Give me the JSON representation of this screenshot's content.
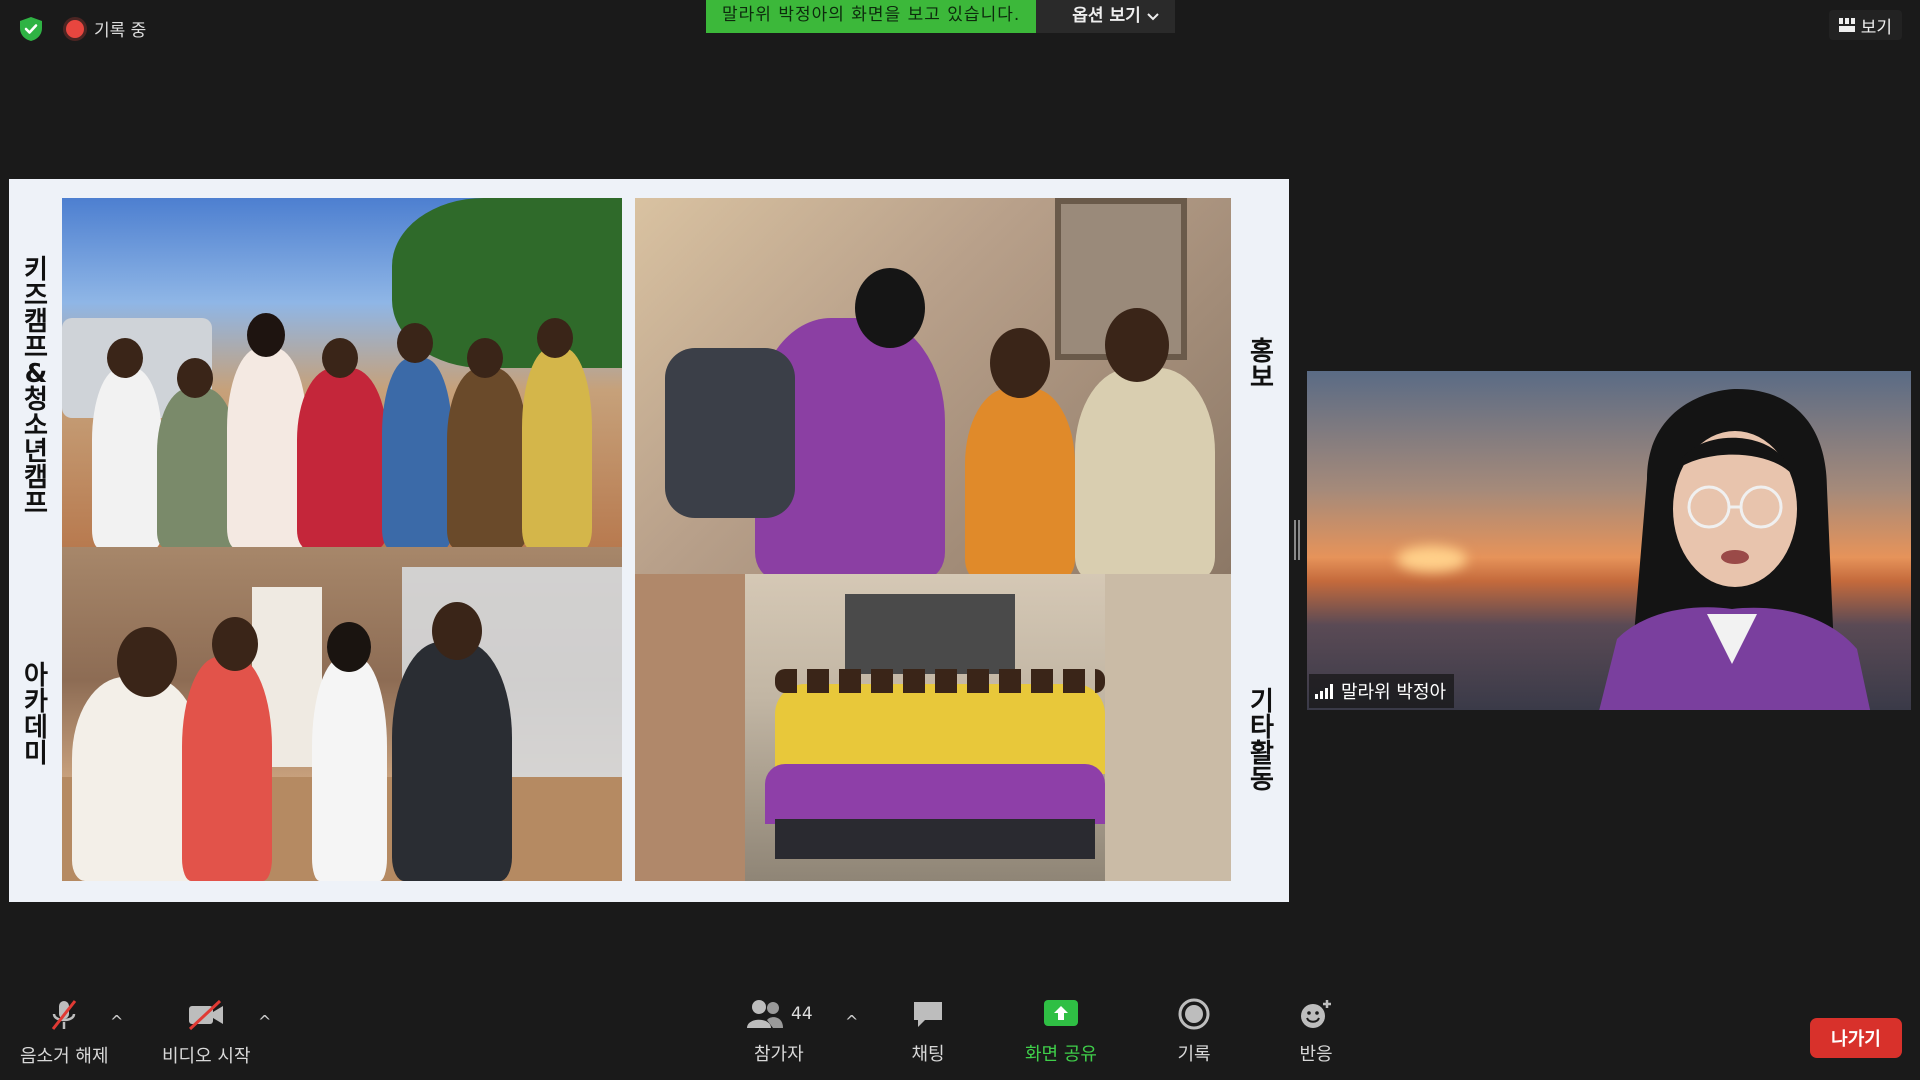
{
  "top": {
    "recording_label": "기록 중",
    "share_banner": "말라위 박정아의 화면을 보고 있습니다.",
    "options_label": "옵션 보기",
    "view_label": "보기"
  },
  "slide": {
    "labels": {
      "top_left": "키즈캠프 & 청소년캠프",
      "bottom_left": "아카데미",
      "top_right": "홍보",
      "bottom_right": "기타활동"
    }
  },
  "speaker": {
    "name": "말라위 박정아"
  },
  "toolbar": {
    "mute_label": "음소거 해제",
    "video_label": "비디오 시작",
    "participants_label": "참가자",
    "participants_count": "44",
    "chat_label": "채팅",
    "share_label": "화면 공유",
    "record_label": "기록",
    "reactions_label": "반응",
    "leave_label": "나가기"
  },
  "colors": {
    "share_green": "#3cb83a",
    "leave_red": "#d8312b",
    "recording_red": "#e8463f"
  }
}
